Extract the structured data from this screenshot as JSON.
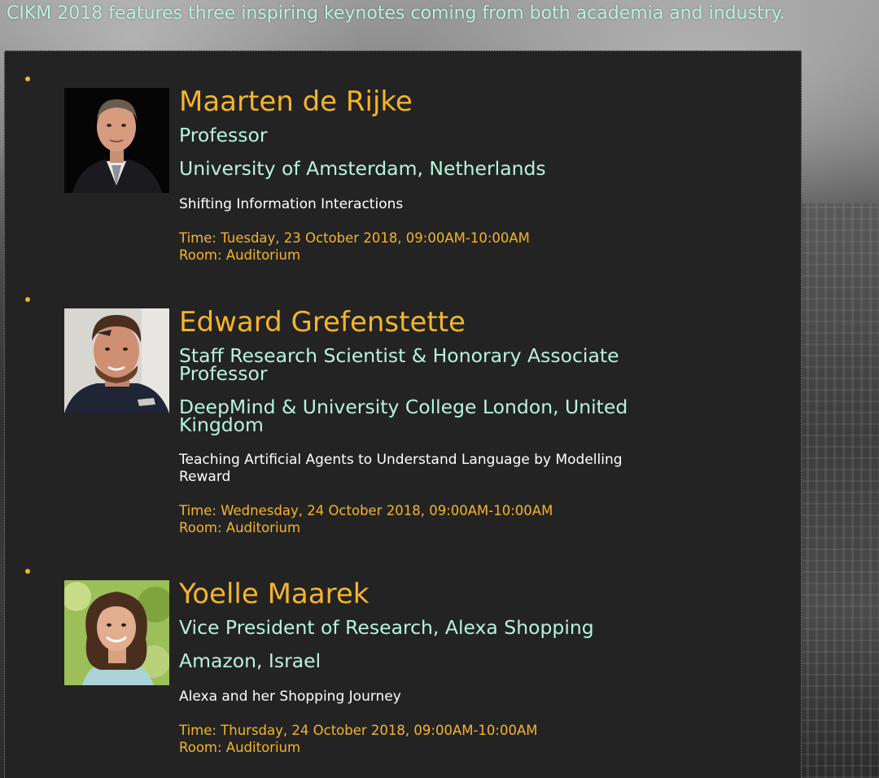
{
  "intro_text": "CIKM 2018 features three inspiring keynotes coming from both academia and industry.",
  "colors": {
    "accent_orange": "#f5b42a",
    "mint_text": "#b8f3dc",
    "panel_bg": "#232323",
    "white_text": "#ffffff"
  },
  "speakers": [
    {
      "name": "Maarten de Rijke",
      "role": "Professor",
      "affiliation": "University of Amsterdam, Netherlands",
      "talk": "Shifting Information Interactions",
      "time": "Time: Tuesday, 23 October 2018, 09:00AM-10:00AM",
      "room": "Room: Auditorium"
    },
    {
      "name": "Edward Grefenstette",
      "role": "Staff Research Scientist & Honorary Associate Professor",
      "affiliation": "DeepMind & University College London, United Kingdom",
      "talk": "Teaching Artificial Agents to Understand Language by Modelling Reward",
      "time": "Time: Wednesday, 24 October 2018, 09:00AM-10:00AM",
      "room": "Room: Auditorium"
    },
    {
      "name": "Yoelle Maarek",
      "role": "Vice President of Research, Alexa Shopping",
      "affiliation": "Amazon, Israel",
      "talk": "Alexa and her Shopping Journey",
      "time": "Time: Thursday, 24 October 2018, 09:00AM-10:00AM",
      "room": "Room: Auditorium"
    }
  ]
}
